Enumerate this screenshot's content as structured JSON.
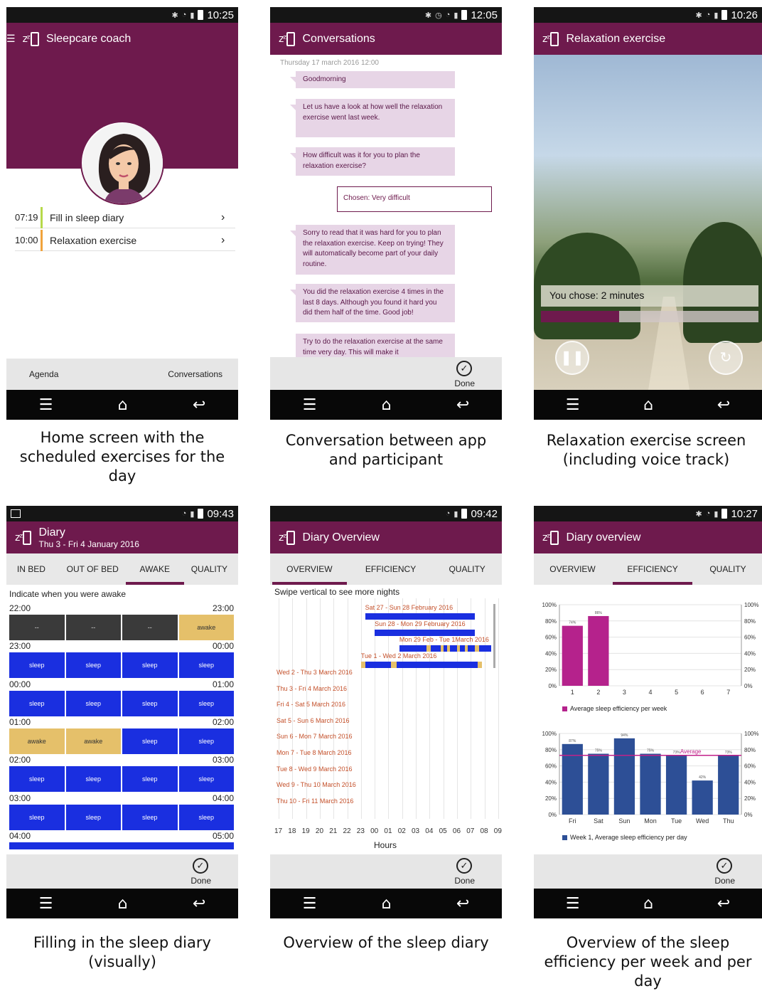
{
  "colors": {
    "brand": "#6e1a4d",
    "sleep": "#1a2fe0",
    "awake": "#e5c06a",
    "week_bar": "#b5228c",
    "day_bar": "#2d4f96",
    "avg_line": "#c2218a"
  },
  "phones": {
    "home": {
      "time": "10:25",
      "title": "Sleepcare coach",
      "agenda": [
        {
          "time": "07:19",
          "label": "Fill in sleep diary",
          "bar_color": "#b7d94a"
        },
        {
          "time": "10:00",
          "label": "Relaxation exercise",
          "bar_color": "#f0a33c"
        }
      ],
      "bottom_left": "Agenda",
      "bottom_right": "Conversations",
      "caption": "Home screen with the scheduled exercises for the day"
    },
    "conversations": {
      "time": "12:05",
      "title": "Conversations",
      "date": "Thursday 17 march 2016 12:00",
      "messages": [
        "Goodmorning",
        "Let us have a look at how well the relaxation exercise went last week.",
        "How difficult was it for you to plan the relaxation exercise?",
        "Sorry to read that it was hard for you to plan the relaxation exercise. Keep on trying! They will automatically become part of your daily routine.",
        "You did the relaxation exercise 4 times in the last 8 days. Although you found it hard you did them half of the time. Good job!",
        "Try to do the relaxation exercise at the same time very day. This will make it"
      ],
      "chosen": "Chosen: Very difficult",
      "done": "Done",
      "caption": "Conversation between app and participant"
    },
    "relaxation": {
      "time": "10:26",
      "title": "Relaxation exercise",
      "chose_text": "You chose: 2 minutes",
      "progress": 0.36,
      "caption": "Relaxation exercise screen (including voice track)"
    },
    "diary": {
      "time": "09:43",
      "title": "Diary",
      "subtitle": "Thu 3 - Fri 4 January 2016",
      "tabs": [
        "IN BED",
        "OUT OF BED",
        "AWAKE",
        "QUALITY"
      ],
      "active_tab": 2,
      "prompt": "Indicate when you were awake",
      "blocks": [
        {
          "start": "22:00",
          "end": "23:00",
          "cells": [
            "--",
            "--",
            "--",
            "awake"
          ],
          "kinds": [
            "none",
            "none",
            "none",
            "awake"
          ]
        },
        {
          "start": "23:00",
          "end": "00:00",
          "cells": [
            "sleep",
            "sleep",
            "sleep",
            "sleep"
          ],
          "kinds": [
            "sleep",
            "sleep",
            "sleep",
            "sleep"
          ]
        },
        {
          "start": "00:00",
          "end": "01:00",
          "cells": [
            "sleep",
            "sleep",
            "sleep",
            "sleep"
          ],
          "kinds": [
            "sleep",
            "sleep",
            "sleep",
            "sleep"
          ]
        },
        {
          "start": "01:00",
          "end": "02:00",
          "cells": [
            "awake",
            "awake",
            "sleep",
            "sleep"
          ],
          "kinds": [
            "awake",
            "awake",
            "sleep",
            "sleep"
          ]
        },
        {
          "start": "02:00",
          "end": "03:00",
          "cells": [
            "sleep",
            "sleep",
            "sleep",
            "sleep"
          ],
          "kinds": [
            "sleep",
            "sleep",
            "sleep",
            "sleep"
          ]
        },
        {
          "start": "03:00",
          "end": "04:00",
          "cells": [
            "sleep",
            "sleep",
            "sleep",
            "sleep"
          ],
          "kinds": [
            "sleep",
            "sleep",
            "sleep",
            "sleep"
          ]
        },
        {
          "start": "04:00",
          "end": "05:00",
          "cells": [],
          "kinds": []
        }
      ],
      "done": "Done",
      "caption": "Filling in the sleep diary (visually)"
    },
    "overview": {
      "time": "09:42",
      "title": "Diary Overview",
      "tabs": [
        "OVERVIEW",
        "EFFICIENCY",
        "QUALITY"
      ],
      "active_tab": 0,
      "swipe": "Swipe vertical to see more nights",
      "nights": [
        "Sat 27 - Sun 28 February 2016",
        "Sun 28 - Mon 29 February 2016",
        "Mon 29 Feb - Tue 1March 2016",
        "Tue 1 - Wed 2 March 2016",
        "Wed 2 - Thu 3 March 2016",
        "Thu 3 - Fri 4 March 2016",
        "Fri 4 - Sat 5 March 2016",
        "Sat 5 - Sun 6 March 2016",
        "Sun 6 - Mon 7 March 2016",
        "Mon 7 - Tue 8 March 2016",
        "Tue 8 - Wed 9 March 2016",
        "Wed 9 - Thu 10 March 2016",
        "Thu 10 - Fri 11 March 2016"
      ],
      "hours": [
        "17",
        "18",
        "19",
        "20",
        "21",
        "22",
        "23",
        "00",
        "01",
        "02",
        "03",
        "04",
        "05",
        "06",
        "07",
        "08",
        "09"
      ],
      "xlabel": "Hours",
      "done": "Done",
      "caption": "Overview of the sleep diary"
    },
    "efficiency": {
      "time": "10:27",
      "title": "Diary overview",
      "tabs": [
        "OVERVIEW",
        "EFFICIENCY",
        "QUALITY"
      ],
      "active_tab": 1,
      "legend_week": "Average sleep efficiency per week",
      "legend_day": "Week 1, Average sleep efficiency per day",
      "avg_label": "Average",
      "done": "Done",
      "caption": "Overview of the sleep efficiency per week and per day"
    }
  },
  "chart_data": [
    {
      "type": "bar",
      "categories": [
        "1",
        "2",
        "3",
        "4",
        "5",
        "6",
        "7"
      ],
      "values": [
        74,
        86,
        null,
        null,
        null,
        null,
        null
      ],
      "ylim": [
        0,
        100
      ],
      "yticks": [
        "0%",
        "20%",
        "40%",
        "60%",
        "80%",
        "100%"
      ],
      "series": [
        {
          "name": "Average sleep efficiency per week",
          "values": [
            74,
            86,
            null,
            null,
            null,
            null,
            null
          ]
        }
      ]
    },
    {
      "type": "bar",
      "categories": [
        "Fri",
        "Sat",
        "Sun",
        "Mon",
        "Tue",
        "Wed",
        "Thu"
      ],
      "values": [
        87,
        75,
        94,
        75,
        73,
        42,
        73
      ],
      "average": 73,
      "ylim": [
        0,
        100
      ],
      "yticks": [
        "0%",
        "20%",
        "40%",
        "60%",
        "80%",
        "100%"
      ],
      "series": [
        {
          "name": "Week 1, Average sleep efficiency per day",
          "values": [
            87,
            75,
            94,
            75,
            73,
            42,
            73
          ]
        }
      ]
    }
  ]
}
